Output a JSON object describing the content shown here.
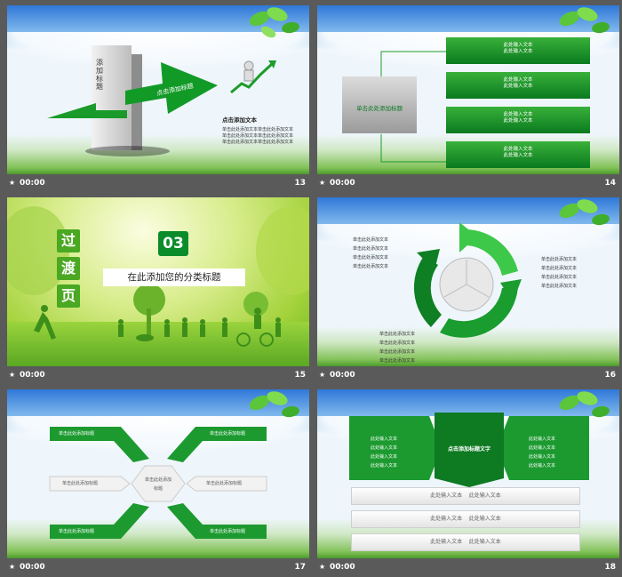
{
  "thumbnails": [
    {
      "time": "00:00",
      "number": "13",
      "big_label": "添加标题",
      "arrow_label": "点击添加标题",
      "heading": "点击添加文本",
      "lines": [
        "单击此处添加文本",
        "单击此处添加文本",
        "单击此处添加文本",
        "单击此处添加文本",
        "单击此处添加文本",
        "单击此处添加文本"
      ]
    },
    {
      "time": "00:00",
      "number": "14",
      "left_label": "单击此处添加标题",
      "boxes": [
        [
          "此处输入文本",
          "此处输入文本"
        ],
        [
          "此处输入文本",
          "此处输入文本"
        ],
        [
          "此处输入文本",
          "此处输入文本"
        ],
        [
          "此处输入文本",
          "此处输入文本"
        ]
      ]
    },
    {
      "time": "00:00",
      "number": "15",
      "vertical_chars": [
        "过",
        "渡",
        "页"
      ],
      "section_number": "03",
      "section_title": "在此添加您的分类标题"
    },
    {
      "time": "00:00",
      "number": "16",
      "labels_top_left": [
        "单击此处添加文本",
        "单击此处添加文本",
        "单击此处添加文本",
        "单击此处添加文本"
      ],
      "labels_right": [
        "单击此处添加文本",
        "单击此处添加文本",
        "单击此处添加文本",
        "单击此处添加文本"
      ],
      "labels_bottom": [
        "单击此处添加文本",
        "单击此处添加文本",
        "单击此处添加文本",
        "单击此处添加文本"
      ]
    },
    {
      "time": "00:00",
      "number": "17",
      "green_labels": [
        "单击此处添加标题",
        "单击此处添加标题",
        "单击此处添加标题",
        "单击此处添加标题"
      ],
      "white_labels": [
        "单击此处添加标题",
        "单击此处添加标题"
      ],
      "center": [
        "单击此处添加",
        "标题"
      ]
    },
    {
      "time": "00:00",
      "number": "18",
      "center_label": "点击添加标题文字",
      "left_lines": [
        "此处输入文本",
        "此处输入文本",
        "此处输入文本",
        "此处输入文本"
      ],
      "right_lines": [
        "此处输入文本",
        "此处输入文本",
        "此处输入文本",
        "此处输入文本"
      ],
      "rows": [
        "此处输入文本    此处输入文本",
        "此处输入文本    此处输入文本",
        "此处输入文本    此处输入文本"
      ]
    }
  ],
  "icons": {
    "thumb_marker": "star-icon"
  }
}
